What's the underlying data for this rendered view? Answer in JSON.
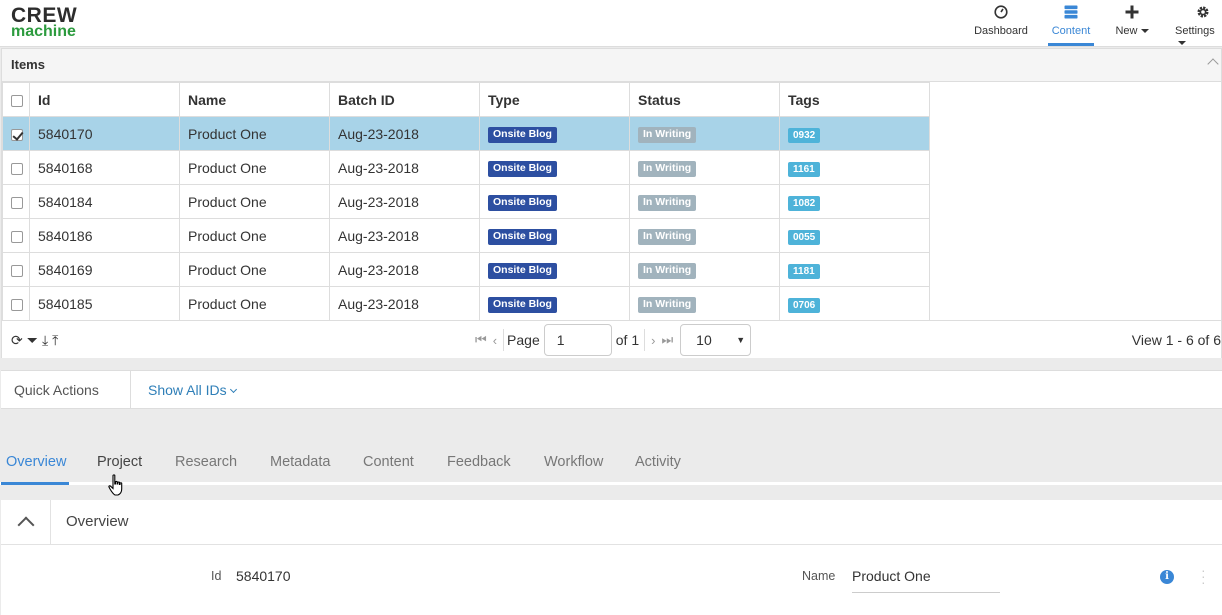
{
  "brand": {
    "line1": "CREW",
    "line2": "machine"
  },
  "nav": {
    "dashboard": "Dashboard",
    "content": "Content",
    "new": "New",
    "settings": "Settings"
  },
  "items_panel": {
    "title": "Items",
    "columns": {
      "id": "Id",
      "name": "Name",
      "batch": "Batch ID",
      "type": "Type",
      "status": "Status",
      "tags": "Tags"
    },
    "rows": [
      {
        "id": "5840170",
        "name": "Product One",
        "batch": "Aug-23-2018",
        "type": "Onsite Blog",
        "status": "In Writing",
        "tag": "0932",
        "checked": true
      },
      {
        "id": "5840168",
        "name": "Product One",
        "batch": "Aug-23-2018",
        "type": "Onsite Blog",
        "status": "In Writing",
        "tag": "1161",
        "checked": false
      },
      {
        "id": "5840184",
        "name": "Product One",
        "batch": "Aug-23-2018",
        "type": "Onsite Blog",
        "status": "In Writing",
        "tag": "1082",
        "checked": false
      },
      {
        "id": "5840186",
        "name": "Product One",
        "batch": "Aug-23-2018",
        "type": "Onsite Blog",
        "status": "In Writing",
        "tag": "0055",
        "checked": false
      },
      {
        "id": "5840169",
        "name": "Product One",
        "batch": "Aug-23-2018",
        "type": "Onsite Blog",
        "status": "In Writing",
        "tag": "1181",
        "checked": false
      },
      {
        "id": "5840185",
        "name": "Product One",
        "batch": "Aug-23-2018",
        "type": "Onsite Blog",
        "status": "In Writing",
        "tag": "0706",
        "checked": false
      }
    ]
  },
  "pager": {
    "page_label": "Page",
    "page_value": "1",
    "of_label": "of 1",
    "page_size": "10",
    "view_text": "View 1 - 6 of 6"
  },
  "quick_actions": {
    "label": "Quick Actions",
    "show_all": "Show All IDs"
  },
  "tabs": [
    "Overview",
    "Project",
    "Research",
    "Metadata",
    "Content",
    "Feedback",
    "Workflow",
    "Activity"
  ],
  "overview": {
    "title": "Overview",
    "id_label": "Id",
    "id_value": "5840170",
    "name_label": "Name",
    "name_value": "Product One"
  },
  "colors": {
    "accent": "#3a87d6",
    "type_badge": "#2d4fa1",
    "status_badge": "#a1b3bd",
    "tag_badge": "#4eb3d9",
    "selected_row": "#a8d3e8",
    "brand_green": "#2c9b3e"
  }
}
